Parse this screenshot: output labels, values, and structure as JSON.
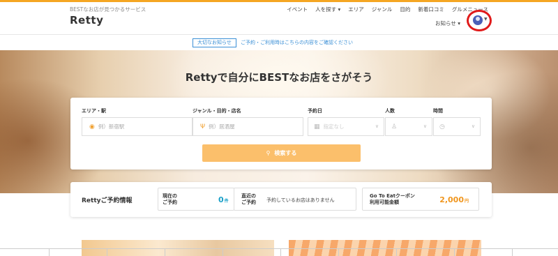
{
  "header": {
    "tagline": "BESTなお店が見つかるサービス",
    "logo": "Retty",
    "nav": [
      "イベント",
      "人を探す ▾",
      "エリア",
      "ジャンル",
      "目的",
      "新着口コミ",
      "グルメニュース"
    ],
    "notice_menu": "お知らせ ▾",
    "avatar_icon": "user-avatar-icon",
    "highlight_color": "#e01a1a"
  },
  "notice_bar": {
    "tag": "大切なお知らせ",
    "text": "ご予約・ご利用時はこちらの内容をご確認ください"
  },
  "hero": {
    "title": "Rettyで自分にBESTなお店をさがそう"
  },
  "search": {
    "area": {
      "label": "エリア・駅",
      "placeholder": "例）新宿駅",
      "icon": "location-pin-icon"
    },
    "genre": {
      "label": "ジャンル・目的・店名",
      "placeholder": "例）居酒屋",
      "icon": "fork-knife-icon"
    },
    "date": {
      "label": "予約日",
      "placeholder": "指定なし",
      "icon": "calendar-icon"
    },
    "people": {
      "label": "人数",
      "placeholder": "",
      "icon": "person-icon"
    },
    "time": {
      "label": "時間",
      "placeholder": "",
      "icon": "clock-icon"
    },
    "button_label": "検索する",
    "button_color": "#fbbf6b"
  },
  "reservation": {
    "title": "Rettyご予約情報",
    "current_label_1": "現在の",
    "current_label_2": "ご予約",
    "current_count": "0",
    "current_unit": "件",
    "recent_label_1": "直近の",
    "recent_label_2": "ご予約",
    "recent_message": "予約しているお店はありません",
    "coupon_label_1": "Go To Eatクーポン",
    "coupon_label_2": "利用可能金額",
    "coupon_amount": "2,000",
    "coupon_unit": "円"
  }
}
